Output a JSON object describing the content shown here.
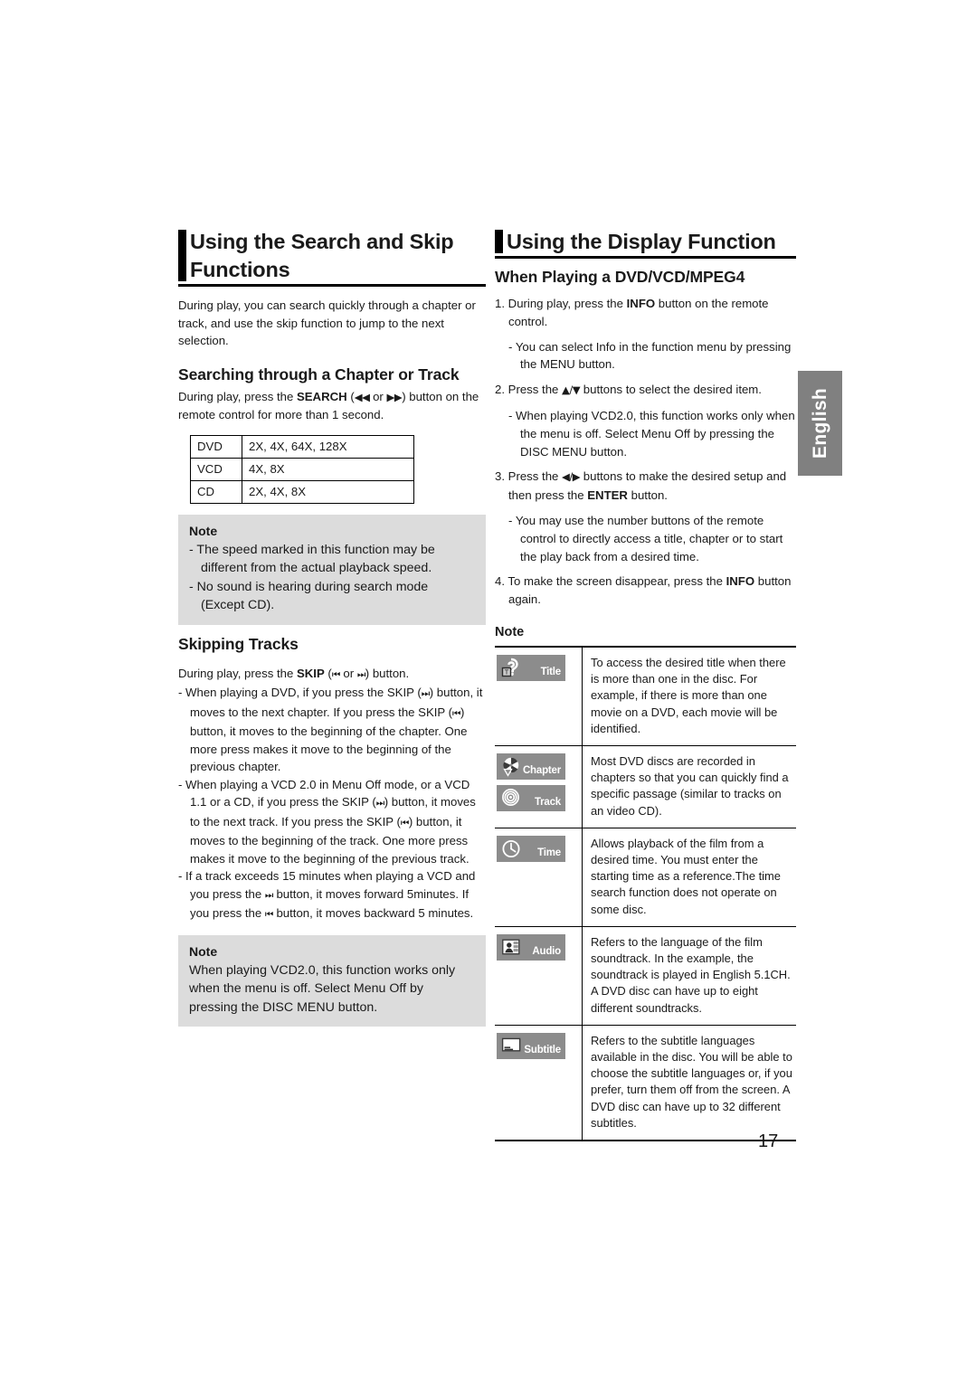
{
  "page": {
    "number": "17",
    "language_tab": "English"
  },
  "left_column": {
    "section_title": "Using the Search and Skip Functions",
    "intro": "During play, you can search quickly through a chapter or track, and use the skip function to jump to the next selection.",
    "subsection_1": {
      "title": "Searching through a Chapter or Track",
      "body_pre": "During play, press the ",
      "body_bold": "SEARCH",
      "body_paren_open": " (",
      "glyph_rew": "◀◀",
      "body_or": " or ",
      "glyph_ff": "▶▶",
      "body_post": ") button on the remote control for more than 1 second."
    },
    "speed_table": {
      "rows": [
        {
          "format": "DVD",
          "speeds": "2X, 4X, 64X, 128X"
        },
        {
          "format": "VCD",
          "speeds": "4X, 8X"
        },
        {
          "format": "CD",
          "speeds": "2X, 4X, 8X"
        }
      ]
    },
    "note_1": {
      "title": "Note",
      "lines": [
        "- The speed marked in this function may be different from the actual playback speed.",
        "- No sound is hearing during search mode (Except CD)."
      ]
    },
    "subsection_2": {
      "title": "Skipping Tracks",
      "lead_pre": "During play, press the ",
      "lead_bold": "SKIP",
      "lead_paren_open": " (",
      "glyph_skip_back": "⏮",
      "lead_or": " or ",
      "glyph_skip_fwd": "⏭",
      "lead_post": ") button.",
      "bullets": [
        {
          "part1": "- When playing a DVD, if you press the SKIP (",
          "g1": "⏭",
          "part2": ") button, it moves to the next chapter. If you press the SKIP (",
          "g2": "⏮",
          "part3": ") button, it moves to the beginning of the chapter. One more press makes it move to the beginning of the previous chapter."
        },
        {
          "part1": "- When playing a VCD 2.0 in Menu Off mode, or a VCD 1.1 or a CD, if you press the SKIP (",
          "g1": "⏭",
          "part2": ") button, it moves to the next track. If you press the SKIP (",
          "g2": "⏮",
          "part3": ") button, it moves to the beginning of the track. One more press makes it move to the beginning of the previous track."
        },
        {
          "part1": "- If a track exceeds 15 minutes when playing a VCD and you press the ",
          "g1": "⏭",
          "part2": " button, it moves forward 5minutes. If you press the ",
          "g2": "⏮",
          "part3": " button, it moves backward 5 minutes."
        }
      ]
    },
    "note_2": {
      "title": "Note",
      "text": "When playing VCD2.0, this function works only when the menu is off. Select Menu Off by pressing the DISC MENU button."
    }
  },
  "right_column": {
    "section_title": "Using the Display Function",
    "subsection_title": "When Playing a DVD/VCD/MPEG4",
    "steps": [
      {
        "num": "1.",
        "pre": " During play, press the ",
        "bold": "INFO",
        "post": " button on the remote control.",
        "subs": [
          "- You can select Info in the function menu by pressing the MENU button."
        ]
      },
      {
        "num": "2.",
        "pre": " Press the ",
        "glyph": "▲/▼",
        "post": " buttons to select the desired item.",
        "subs": [
          "- When playing VCD2.0, this function works only when the menu is off. Select Menu Off by pressing the DISC MENU button."
        ]
      },
      {
        "num": "3.",
        "pre": " Press the ",
        "glyph": "◀/▶",
        "mid": " buttons to make the desired setup and then press the ",
        "bold": "ENTER",
        "post": " button.",
        "subs": [
          "- You may use the number buttons of the remote control to directly access a title, chapter or to start the play back from a desired time."
        ]
      },
      {
        "num": "4.",
        "pre": " To make the screen disappear, press the ",
        "bold": "INFO",
        "post": " button again.",
        "subs": []
      }
    ],
    "note_title": "Note",
    "icon_table": {
      "rows": [
        {
          "badges": [
            {
              "label": "Title",
              "icon": "title-icon"
            }
          ],
          "description": "To access the desired title when there is more than one in the disc. For example, if there is more than one movie on a DVD, each movie will be identified."
        },
        {
          "badges": [
            {
              "label": "Chapter",
              "icon": "chapter-icon"
            },
            {
              "label": "Track",
              "icon": "track-icon"
            }
          ],
          "description": "Most DVD discs are recorded in chapters so that you can quickly find a specific passage (similar to tracks on an video CD)."
        },
        {
          "badges": [
            {
              "label": "Time",
              "icon": "time-icon"
            }
          ],
          "description": "Allows playback of the film from a desired time. You must enter the starting time as a reference.The time search function does not operate on some disc."
        },
        {
          "badges": [
            {
              "label": "Audio",
              "icon": "audio-icon"
            }
          ],
          "description": "Refers to the language of the film soundtrack. In the example, the soundtrack is played in English 5.1CH. A DVD disc can have up to eight different soundtracks."
        },
        {
          "badges": [
            {
              "label": "Subtitle",
              "icon": "subtitle-icon"
            }
          ],
          "description": "Refers to the subtitle languages available in the disc. You will be able to choose the subtitle languages or, if you prefer, turn them off from the screen. A DVD disc can have up to 32 different subtitles."
        }
      ]
    }
  },
  "colors": {
    "note_background": "#dcdcdc",
    "badge_background": "#8c8c8c",
    "lang_tab_background": "#808080",
    "rule": "#000000"
  }
}
